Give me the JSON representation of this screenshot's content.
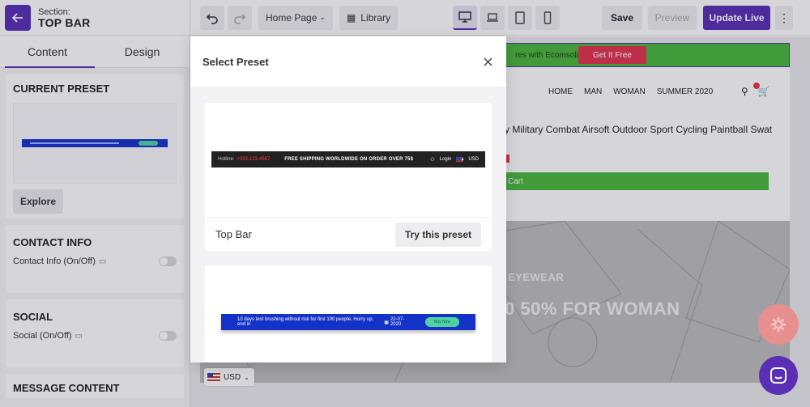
{
  "left_panel": {
    "section_label": "Section:",
    "section_title": "TOP BAR",
    "tabs": [
      {
        "label": "Content",
        "active": true
      },
      {
        "label": "Design",
        "active": false
      }
    ],
    "current_preset": {
      "title": "CURRENT PRESET",
      "explore_label": "Explore"
    },
    "contact_info": {
      "title": "CONTACT INFO",
      "toggle_label": "Contact Info (On/Off)"
    },
    "social": {
      "title": "SOCIAL",
      "toggle_label": "Social (On/Off)"
    },
    "message_content": {
      "title": "MESSAGE CONTENT"
    }
  },
  "toolbar": {
    "page_select": "Home Page",
    "library_label": "Library",
    "save_label": "Save",
    "preview_label": "Preview",
    "update_live_label": "Update Live",
    "accent_color": "#5a2fb5"
  },
  "store_preview": {
    "promo_text": "res with Ecomsolid",
    "promo_button": "Get It Free",
    "nav": [
      "HOME",
      "MAN",
      "WOMAN",
      "SUMMER 2020"
    ],
    "product_title": "y Military Combat Airsoft Outdoor Sport Cycling Paintball Swat",
    "cart_button": "Cart",
    "hero_line1": "EYEWEAR",
    "hero_line2": "0 50% FOR WOMAN",
    "currency": "USD"
  },
  "modal": {
    "title": "Select Preset",
    "presets": [
      {
        "name": "Top Bar",
        "try_label": "Try this preset",
        "preview": {
          "hotline_label": "Hotline:",
          "hotline_number": "+333-123-4567",
          "shipping": "FREE SHIPPING WORLDWIDE ON ORDER OVER 75$",
          "login": "Login",
          "currency": "USD"
        }
      },
      {
        "preview": {
          "message": "10 days test brushing without risk for first 100 people. Hurry up, end in",
          "date": "22-07-2020",
          "button": "Buy Now"
        }
      }
    ]
  }
}
